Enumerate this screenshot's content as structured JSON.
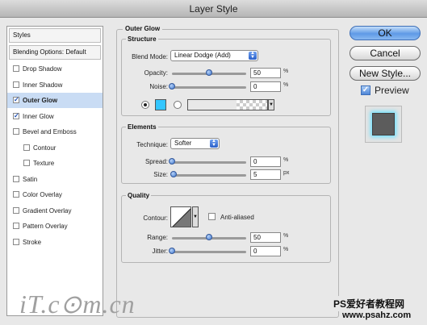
{
  "window": {
    "title": "Layer Style"
  },
  "sidebar": {
    "styles_label": "Styles",
    "blending_label": "Blending Options: Default",
    "items": [
      {
        "label": "Drop Shadow",
        "checked": false,
        "selected": false,
        "indent": false
      },
      {
        "label": "Inner Shadow",
        "checked": false,
        "selected": false,
        "indent": false
      },
      {
        "label": "Outer Glow",
        "checked": true,
        "selected": true,
        "indent": false
      },
      {
        "label": "Inner Glow",
        "checked": true,
        "selected": false,
        "indent": false
      },
      {
        "label": "Bevel and Emboss",
        "checked": false,
        "selected": false,
        "indent": false
      },
      {
        "label": "Contour",
        "checked": false,
        "selected": false,
        "indent": true
      },
      {
        "label": "Texture",
        "checked": false,
        "selected": false,
        "indent": true
      },
      {
        "label": "Satin",
        "checked": false,
        "selected": false,
        "indent": false
      },
      {
        "label": "Color Overlay",
        "checked": false,
        "selected": false,
        "indent": false
      },
      {
        "label": "Gradient Overlay",
        "checked": false,
        "selected": false,
        "indent": false
      },
      {
        "label": "Pattern Overlay",
        "checked": false,
        "selected": false,
        "indent": false
      },
      {
        "label": "Stroke",
        "checked": false,
        "selected": false,
        "indent": false
      }
    ]
  },
  "panel": {
    "title": "Outer Glow",
    "structure": {
      "heading": "Structure",
      "blend_mode_label": "Blend Mode:",
      "blend_mode_value": "Linear Dodge (Add)",
      "opacity_label": "Opacity:",
      "opacity_value": "50",
      "opacity_level": 0.5,
      "opacity_unit": "%",
      "noise_label": "Noise:",
      "noise_value": "0",
      "noise_level": 0,
      "noise_unit": "%",
      "glow_color": "#33c6ff",
      "color_mode": "solid"
    },
    "elements": {
      "heading": "Elements",
      "technique_label": "Technique:",
      "technique_value": "Softer",
      "spread_label": "Spread:",
      "spread_value": "0",
      "spread_level": 0,
      "spread_unit": "%",
      "size_label": "Size:",
      "size_value": "5",
      "size_level": 0.02,
      "size_unit": "px"
    },
    "quality": {
      "heading": "Quality",
      "contour_label": "Contour:",
      "anti_aliased_label": "Anti-aliased",
      "anti_aliased": false,
      "range_label": "Range:",
      "range_value": "50",
      "range_level": 0.5,
      "range_unit": "%",
      "jitter_label": "Jitter:",
      "jitter_value": "0",
      "jitter_level": 0,
      "jitter_unit": "%"
    }
  },
  "buttons": {
    "ok": "OK",
    "cancel": "Cancel",
    "new_style": "New Style...",
    "preview_label": "Preview",
    "preview_checked": true
  },
  "watermark": {
    "left_text": "iT.c⊙m.cn",
    "right_text": "PS爱好者教程网",
    "url": "www.psahz.com"
  }
}
